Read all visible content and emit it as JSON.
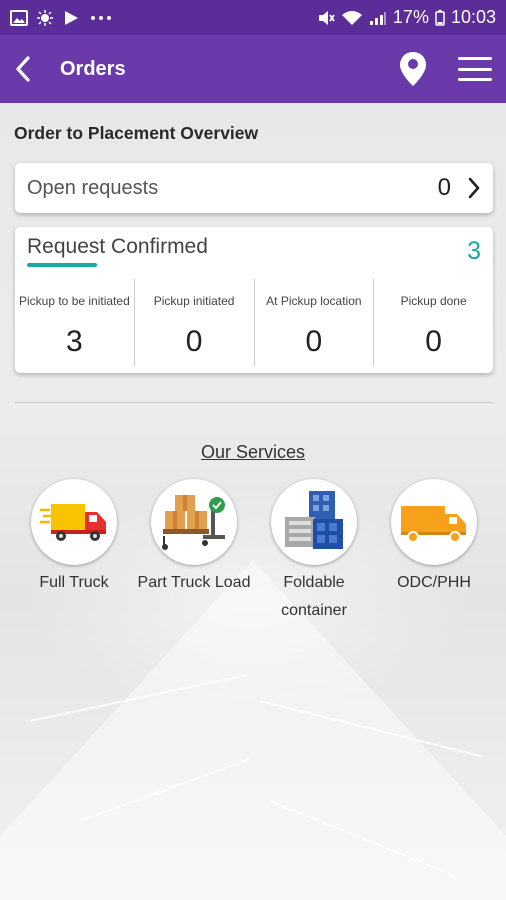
{
  "status_bar": {
    "battery": "17%",
    "time": "10:03",
    "icons_left": [
      "image-icon",
      "brightness-icon",
      "play-icon",
      "more-dots-icon"
    ],
    "icons_right": [
      "mute-icon",
      "wifi-icon",
      "signal-icon",
      "battery-icon"
    ]
  },
  "app_bar": {
    "title": "Orders",
    "back_icon": "back-chevron-icon",
    "location_icon": "location-pin-icon",
    "menu_icon": "hamburger-menu-icon"
  },
  "overview": {
    "title": "Order to Placement Overview",
    "open_requests": {
      "label": "Open requests",
      "count": "0"
    },
    "request_confirmed": {
      "label": "Request Confirmed",
      "count": "3",
      "stats": [
        {
          "label": "Pickup to be initiated",
          "value": "3"
        },
        {
          "label": "Pickup initiated",
          "value": "0"
        },
        {
          "label": "At Pickup location",
          "value": "0"
        },
        {
          "label": "Pickup done",
          "value": "0"
        }
      ]
    }
  },
  "services": {
    "title": "Our Services",
    "items": [
      {
        "label": "Full Truck",
        "icon": "full-truck-icon"
      },
      {
        "label": "Part Truck Load",
        "icon": "part-truck-load-icon"
      },
      {
        "label": "Foldable container",
        "icon": "foldable-container-icon"
      },
      {
        "label": "ODC/PHH",
        "icon": "odc-truck-icon"
      }
    ]
  },
  "colors": {
    "status_bar": "#5b2d98",
    "app_bar": "#6a3aaa",
    "accent": "#1aa8a0"
  }
}
